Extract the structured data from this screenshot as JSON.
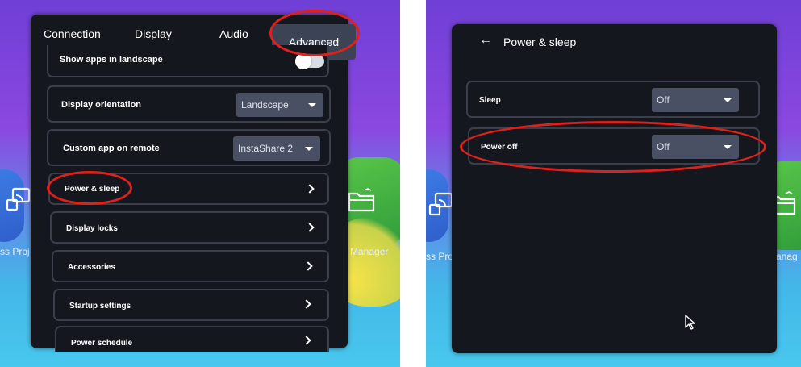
{
  "left_panel": {
    "tabs": {
      "connection": "Connection",
      "display": "Display",
      "audio": "Audio",
      "advanced": "Advanced"
    },
    "rows": {
      "show_apps_landscape": "Show apps in landscape",
      "display_orientation": "Display orientation",
      "display_orientation_value": "Landscape",
      "custom_app_remote": "Custom app on remote",
      "custom_app_remote_value": "InstaShare 2",
      "power_sleep": "Power & sleep",
      "display_locks": "Display locks",
      "accessories": "Accessories",
      "startup_settings": "Startup settings",
      "power_schedule": "Power schedule"
    },
    "show_apps_landscape_on": false
  },
  "right_panel": {
    "title": "Power & sleep",
    "sleep_label": "Sleep",
    "sleep_value": "Off",
    "power_off_label": "Power off",
    "power_off_value": "Off"
  },
  "desktop": {
    "left_label_left": "ss Proj",
    "left_label_right": "e Manager",
    "right_label_left": "ss Proj",
    "right_label_right": "e Manag"
  },
  "annotation_color": "#e0201b",
  "icons": [
    "back-arrow-icon",
    "chevron-right-icon",
    "dropdown-arrow-icon",
    "cast-icon",
    "folder-icon",
    "mouse-cursor-icon"
  ]
}
